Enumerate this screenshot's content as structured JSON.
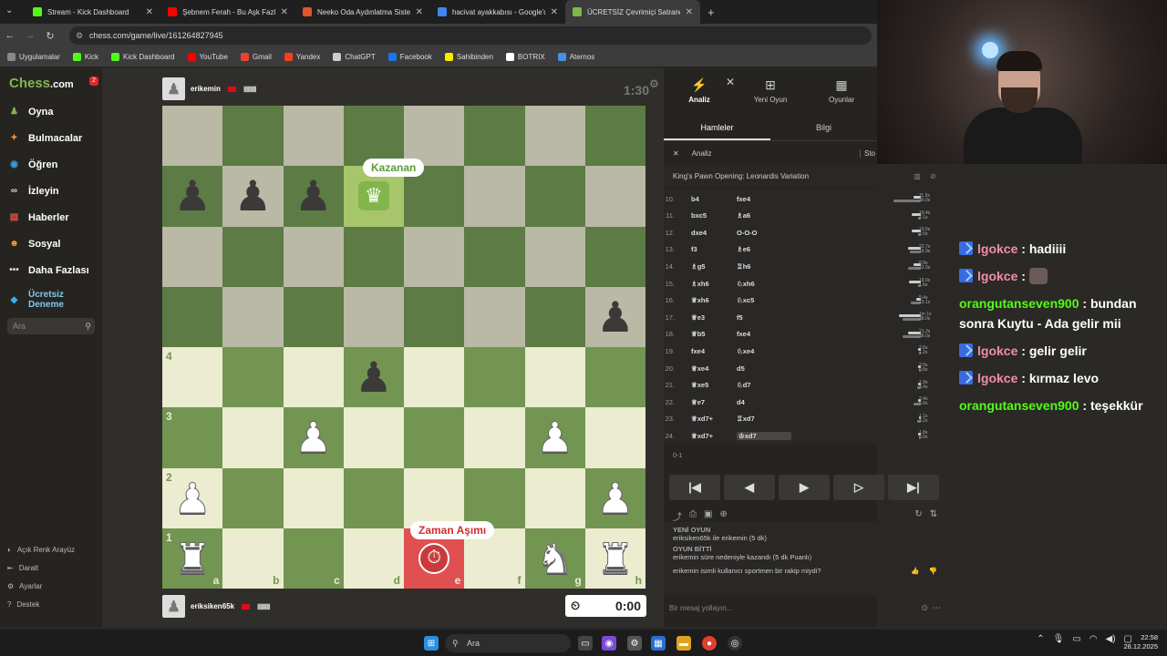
{
  "browser": {
    "tabs": [
      {
        "title": "Stream - Kick Dashboard",
        "color": "#53fc18",
        "active": false
      },
      {
        "title": "Şebnem Ferah - Bu Aşk Fazl",
        "color": "#ff0000",
        "active": false
      },
      {
        "title": "Neeko Oda Aydınlatma Sistem",
        "color": "#e0552b",
        "active": false
      },
      {
        "title": "hacivat ayakkabısı - Google'da",
        "color": "#4285f4",
        "active": false
      },
      {
        "title": "ÜCRETSİZ Çevrimiçi Satranç",
        "color": "#81b64c",
        "active": true
      }
    ],
    "url": "chess.com/game/live/161264827945",
    "bookmarks": [
      {
        "label": "Uygulamalar",
        "color": "#888"
      },
      {
        "label": "Kick",
        "color": "#53fc18"
      },
      {
        "label": "Kick Dashboard",
        "color": "#53fc18"
      },
      {
        "label": "YouTube",
        "color": "#ff0000"
      },
      {
        "label": "Gmail",
        "color": "#ea4335"
      },
      {
        "label": "Yandex",
        "color": "#fc3f1d"
      },
      {
        "label": "ChatGPT",
        "color": "#cccccc"
      },
      {
        "label": "Facebook",
        "color": "#1877f2"
      },
      {
        "label": "Sahibinden",
        "color": "#ffe800"
      },
      {
        "label": "BOTRIX",
        "color": "#ffffff"
      },
      {
        "label": "Aternos",
        "color": "#4a90e2"
      }
    ]
  },
  "sidebar": {
    "logo_a": "Chess",
    "logo_b": ".com",
    "notif": "2",
    "items": [
      {
        "label": "Oyna",
        "icon": "pawn-icon",
        "color": "#81b64c"
      },
      {
        "label": "Bulmacalar",
        "icon": "puzzle-icon",
        "color": "#f08a32"
      },
      {
        "label": "Öğren",
        "icon": "learn-icon",
        "color": "#3aa0e0"
      },
      {
        "label": "İzleyin",
        "icon": "binoculars-icon",
        "color": "#dddddd"
      },
      {
        "label": "Haberler",
        "icon": "news-icon",
        "color": "#e0553a"
      },
      {
        "label": "Sosyal",
        "icon": "social-icon",
        "color": "#f0a030"
      },
      {
        "label": "Daha Fazlası",
        "icon": "more-icon",
        "color": "#dddddd"
      },
      {
        "label": "Ücretsiz Deneme",
        "icon": "diamond-icon",
        "color": "#3ab0e8"
      }
    ],
    "search_placeholder": "Ara",
    "bottom": [
      "Açık Renk Arayüz",
      "Daralt",
      "Ayarlar",
      "Destek"
    ]
  },
  "game": {
    "top_player": "erikemin",
    "top_clock": "1:30",
    "bottom_player": "eriksiken65k",
    "bottom_clock": "0:00",
    "winner_label": "Kazanan",
    "timeout_label": "Zaman Aşımı",
    "ranks": [
      "4",
      "3",
      "2",
      "1"
    ],
    "files": [
      "a",
      "b",
      "c",
      "d",
      "e",
      "f",
      "g",
      "h"
    ]
  },
  "panel": {
    "tabs_top": [
      {
        "label": "Analiz",
        "icon": "bolt-icon"
      },
      {
        "label": "Yeni Oyun",
        "icon": "plus-icon"
      },
      {
        "label": "Oyunlar",
        "icon": "board-icon"
      }
    ],
    "subtabs": [
      "Hamleler",
      "Bilgi"
    ],
    "analiz_label": "Analiz",
    "analiz_right": "Sto",
    "opening": "King's Pawn Opening: Leonardis Variation",
    "moves": [
      {
        "n": "10.",
        "w": "b4",
        "b": "fxe4",
        "tw": "11.5s",
        "tb": "30.0s",
        "ww": 8,
        "wb": 30
      },
      {
        "n": "11.",
        "w": "bxc5",
        "b": "♗a6",
        "tw": "10.4s",
        "tb": "2.1s",
        "ww": 10,
        "wb": 3
      },
      {
        "n": "12.",
        "w": "dxe4",
        "b": "O-O-O",
        "tw": "10.5s",
        "tb": "2.0s",
        "ww": 10,
        "wb": 3
      },
      {
        "n": "13.",
        "w": "f3",
        "b": "♗e6",
        "tw": "22.7s",
        "tb": "16.9s",
        "ww": 14,
        "wb": 12
      },
      {
        "n": "14.",
        "w": "♗g5",
        "b": "♖h6",
        "tw": "8.9s",
        "tb": "22.0s",
        "ww": 8,
        "wb": 14
      },
      {
        "n": "15.",
        "w": "♗xh6",
        "b": "♘xh6",
        "tw": "19.0s",
        "tb": "1.6s",
        "ww": 13,
        "wb": 3
      },
      {
        "n": "16.",
        "w": "♕xh6",
        "b": "♘xc5",
        "tw": "5.4s",
        "tb": "15.1s",
        "ww": 5,
        "wb": 11
      },
      {
        "n": "17.",
        "w": "♕e3",
        "b": "f5",
        "tw": "1m 1s",
        "tb": "38.0s",
        "ww": 24,
        "wb": 20
      },
      {
        "n": "18.",
        "w": "♕b5",
        "b": "fxe4",
        "tw": "21.2s",
        "tb": "38.0s",
        "ww": 14,
        "wb": 20
      },
      {
        "n": "19.",
        "w": "fxe4",
        "b": "♘xe4",
        "tw": "2.6s",
        "tb": "1.2s",
        "ww": 3,
        "wb": 2
      },
      {
        "n": "20.",
        "w": "♕xe4",
        "b": "d5",
        "tw": "2.5s",
        "tb": "0.8s",
        "ww": 3,
        "wb": 2
      },
      {
        "n": "21.",
        "w": "♕xe5",
        "b": "♘d7",
        "tw": "1.9s",
        "tb": "3.4s",
        "ww": 3,
        "wb": 4
      },
      {
        "n": "22.",
        "w": "♕e7",
        "b": "d4",
        "tw": "2.4s",
        "tb": "9.9s",
        "ww": 3,
        "wb": 8
      },
      {
        "n": "23.",
        "w": "♕xd7+",
        "b": "♖xd7",
        "tw": "1.1s",
        "tb": "3.2s",
        "ww": 2,
        "wb": 4
      },
      {
        "n": "24.",
        "w": "♕xd7+",
        "b": "♔xd7",
        "tw": "1.8s",
        "tb": "0.9s",
        "ww": 3,
        "wb": 2
      }
    ],
    "result": "0-1",
    "chat": {
      "new_game_header": "YENİ OYUN",
      "new_game_text": "eriksiken65k ile erikemin (5 dk)",
      "game_over_header": "OYUN BİTTİ",
      "game_over_text": "erikemin süre nedeniyle kazandı (5 dk Puanlı)",
      "question": "erikemin isimli kullanıcı sportmen bir rakip miydi?",
      "input_placeholder": "Bir mesaj yollayın..."
    }
  },
  "stream_chat": [
    {
      "user": "lgokce",
      "text": "hadiiii",
      "badge": true,
      "color": "#f08ea7",
      "emote": false
    },
    {
      "user": "lgokce",
      "text": "",
      "badge": true,
      "color": "#f08ea7",
      "emote": true
    },
    {
      "user": "orangutanseven900",
      "text": "bundan sonra Kuytu - Ada gelir mii",
      "badge": false,
      "color": "#53fc18",
      "emote": false
    },
    {
      "user": "lgokce",
      "text": "gelir gelir",
      "badge": true,
      "color": "#f08ea7",
      "emote": false
    },
    {
      "user": "lgokce",
      "text": "kırmaz levo",
      "badge": true,
      "color": "#f08ea7",
      "emote": false
    },
    {
      "user": "orangutanseven900",
      "text": "teşekkür",
      "badge": false,
      "color": "#53fc18",
      "emote": false
    }
  ],
  "taskbar": {
    "search": "Ara",
    "time": "22:58",
    "date": "28.12.2025"
  }
}
